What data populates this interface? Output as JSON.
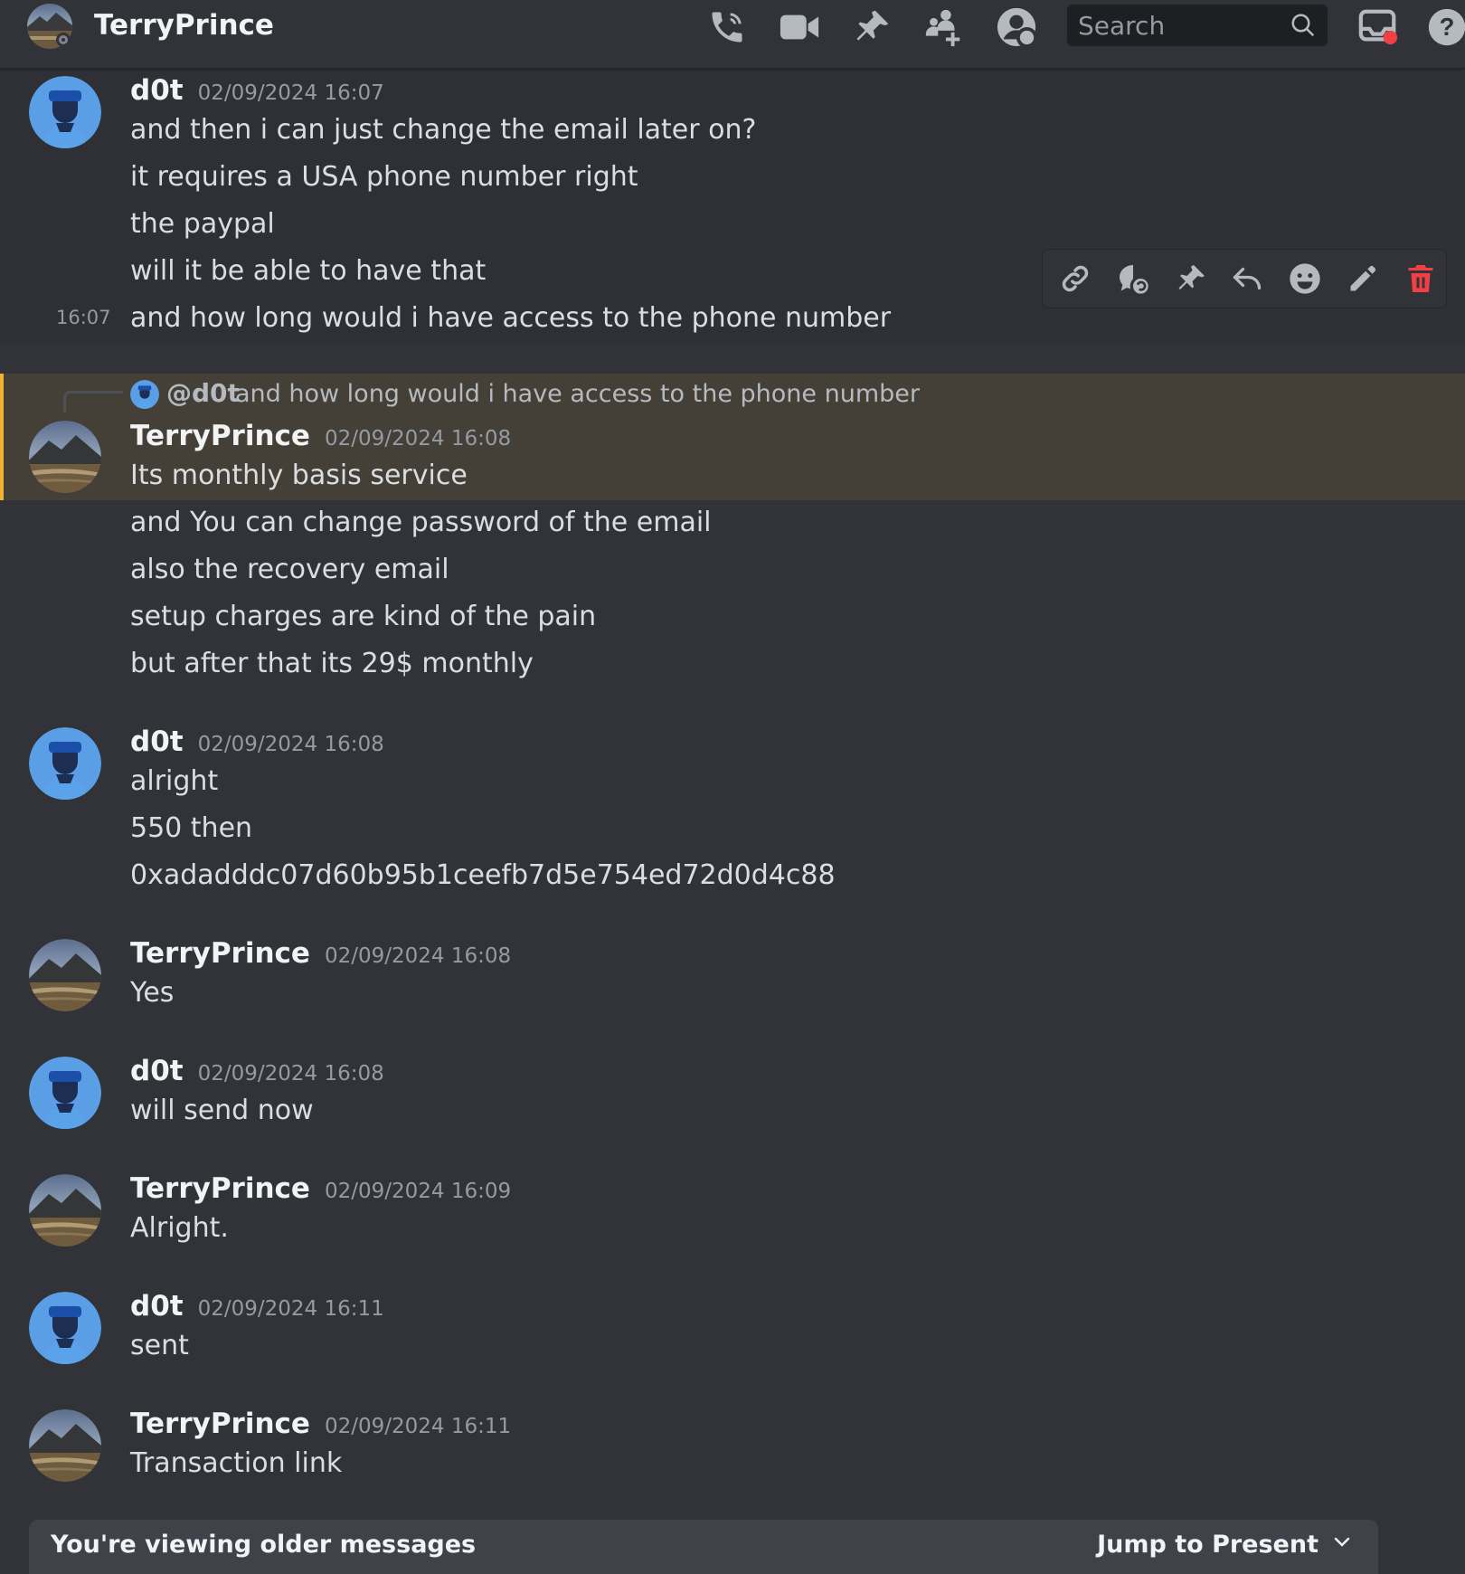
{
  "header": {
    "title": "TerryPrince",
    "search_placeholder": "Search",
    "icons": [
      "call-icon",
      "video-icon",
      "pin-icon",
      "add-member-icon",
      "user-profile-icon",
      "search-icon",
      "inbox-icon",
      "help-icon"
    ]
  },
  "toolbar": {
    "icons": [
      "link-icon",
      "thread-icon",
      "pin-icon",
      "reply-icon",
      "emoji-icon",
      "edit-icon",
      "delete-icon"
    ]
  },
  "messages": [
    {
      "author": "d0t",
      "timestamp": "02/09/2024 16:07",
      "lines": [
        "and then i can just change the email later on?",
        "it requires a USA phone number right",
        "the paypal",
        "will it be able to have that",
        "and how long would i have access to the phone number"
      ],
      "hover_time": "16:07"
    },
    {
      "reply": {
        "mention": "@d0t",
        "text": "and how long would i have access to the phone number"
      },
      "author": "TerryPrince",
      "timestamp": "02/09/2024 16:08",
      "lines": [
        "Its monthly basis service",
        "and You can change password of the email",
        "also the recovery email",
        "setup charges are kind of the pain",
        "but after that its 29$ monthly"
      ]
    },
    {
      "author": "d0t",
      "timestamp": "02/09/2024 16:08",
      "lines": [
        "alright",
        "550 then",
        "0xadadddc07d60b95b1ceefb7d5e754ed72d0d4c88"
      ]
    },
    {
      "author": "TerryPrince",
      "timestamp": "02/09/2024 16:08",
      "lines": [
        "Yes"
      ]
    },
    {
      "author": "d0t",
      "timestamp": "02/09/2024 16:08",
      "lines": [
        "will send now"
      ]
    },
    {
      "author": "TerryPrince",
      "timestamp": "02/09/2024 16:09",
      "lines": [
        "Alright."
      ]
    },
    {
      "author": "d0t",
      "timestamp": "02/09/2024 16:11",
      "lines": [
        "sent"
      ]
    },
    {
      "author": "TerryPrince",
      "timestamp": "02/09/2024 16:11",
      "lines": [
        "Transaction link"
      ]
    }
  ],
  "footer": {
    "older_notice": "You're viewing older messages",
    "jump_label": "Jump to Present"
  },
  "colors": {
    "background": "#313338",
    "mention_highlight": "#444037",
    "mention_bar": "#f0b232",
    "delete_red": "#f23f43",
    "timestamp": "#949ba4"
  }
}
